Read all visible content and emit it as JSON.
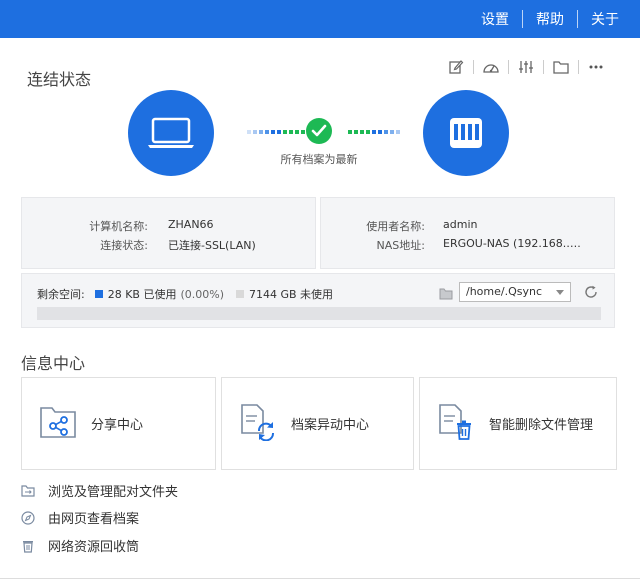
{
  "header": {
    "nav": [
      "设置",
      "帮助",
      "关于"
    ],
    "bg_color": "#1e6fe0"
  },
  "connection": {
    "title": "连结状态",
    "toolbar_icons": [
      "edit-icon",
      "speedometer-icon",
      "sliders-icon",
      "folder-icon",
      "more-icon"
    ],
    "sync_status": "所有档案为最新",
    "computer_name_label": "计算机名称:",
    "computer_name": "ZHAN66",
    "connection_status_label": "连接状态:",
    "connection_status": "已连接-SSL(LAN)",
    "user_name_label": "使用者名称:",
    "user_name": "admin",
    "nas_address_label": "NAS地址:",
    "nas_address": "ERGOU-NAS (192.168.…."
  },
  "storage": {
    "free_space_label": "剩余空间:",
    "used_text": "28 KB 已使用",
    "used_percent_text": "(0.00%)",
    "unused_text": "7144  GB 未使用",
    "used_fraction": 0.0,
    "path": "/home/.Qsync",
    "used_color": "#1e6fe0",
    "unused_color": "#d9d9d9"
  },
  "info_center": {
    "title": "信息中心",
    "cards": [
      {
        "label": "分享中心",
        "icon": "share-folder-icon"
      },
      {
        "label": "档案异动中心",
        "icon": "file-sync-icon"
      },
      {
        "label": "智能删除文件管理",
        "icon": "file-delete-icon"
      }
    ],
    "links": [
      {
        "label": "浏览及管理配对文件夹",
        "icon": "paired-folder-icon"
      },
      {
        "label": "由网页查看档案",
        "icon": "compass-icon"
      },
      {
        "label": "网络资源回收筒",
        "icon": "recycle-bin-icon"
      }
    ]
  }
}
